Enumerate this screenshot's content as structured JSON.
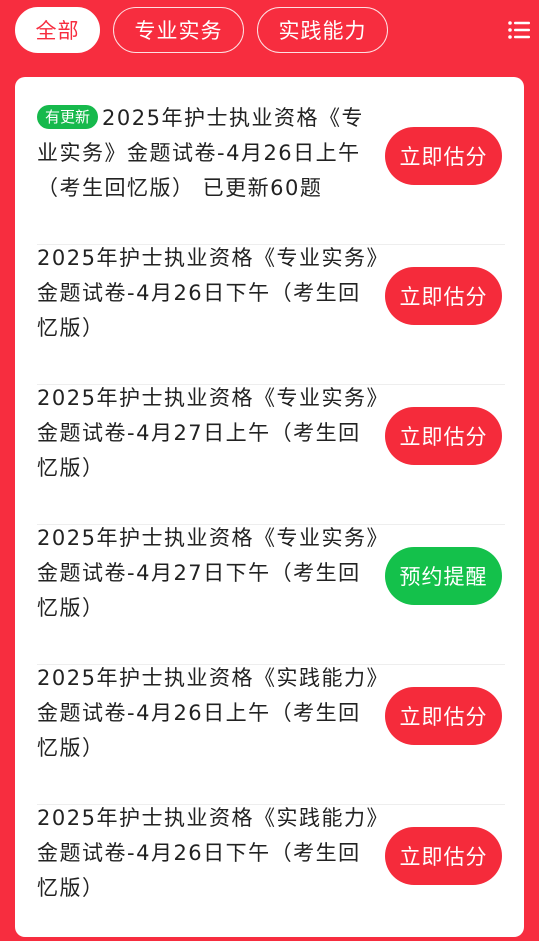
{
  "tabs": [
    "全部",
    "专业实务",
    "实践能力"
  ],
  "badge": "有更新",
  "items": [
    {
      "title": "2025年护士执业资格《专业实务》金题试卷-4月26日上午（考生回忆版） 已更新60题",
      "button": "立即估分",
      "button_type": "red"
    },
    {
      "title": "2025年护士执业资格《专业实务》金题试卷-4月26日下午（考生回忆版）",
      "button": "立即估分",
      "button_type": "red"
    },
    {
      "title": "2025年护士执业资格《专业实务》金题试卷-4月27日上午（考生回忆版）",
      "button": "立即估分",
      "button_type": "red"
    },
    {
      "title": "2025年护士执业资格《专业实务》金题试卷-4月27日下午（考生回忆版）",
      "button": "预约提醒",
      "button_type": "green"
    },
    {
      "title": "2025年护士执业资格《实践能力》金题试卷-4月26日上午（考生回忆版）",
      "button": "立即估分",
      "button_type": "red"
    },
    {
      "title": "2025年护士执业资格《实践能力》金题试卷-4月26日下午（考生回忆版）",
      "button": "立即估分",
      "button_type": "red"
    }
  ],
  "colors": {
    "primary": "#f72d3f",
    "green": "#14c14b",
    "badge": "#16b94c"
  },
  "icons": {
    "menu": "list-menu-icon"
  }
}
